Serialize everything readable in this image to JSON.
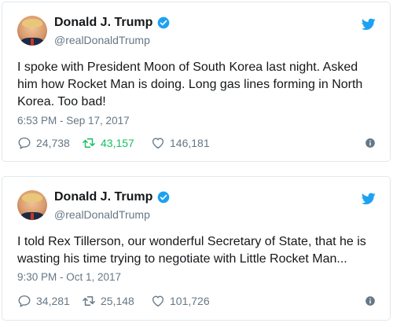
{
  "colors": {
    "brand_blue": "#1da1f2",
    "retweet_green": "#17bf63",
    "muted_gray": "#657786",
    "border": "#e1e8ed"
  },
  "icons": {
    "bird": "twitter-bird-icon",
    "verified": "verified-badge-icon",
    "reply": "reply-icon",
    "retweet": "retweet-icon",
    "like": "heart-icon",
    "info": "info-icon"
  },
  "tweets": [
    {
      "author": {
        "name": "Donald J. Trump",
        "handle": "@realDonaldTrump",
        "verified": true
      },
      "text": "I spoke with President Moon of South Korea last night. Asked him how Rocket Man is doing. Long gas lines forming in North Korea. Too bad!",
      "timestamp": "6:53 PM - Sep 17, 2017",
      "counts": {
        "replies": "24,738",
        "retweets": "43,157",
        "likes": "146,181"
      },
      "retweeted": true
    },
    {
      "author": {
        "name": "Donald J. Trump",
        "handle": "@realDonaldTrump",
        "verified": true
      },
      "text": "I told Rex Tillerson, our wonderful Secretary of State, that he is wasting his time trying to negotiate with Little Rocket Man...",
      "timestamp": "9:30 PM - Oct 1, 2017",
      "counts": {
        "replies": "34,281",
        "retweets": "25,148",
        "likes": "101,726"
      },
      "retweeted": false
    }
  ]
}
